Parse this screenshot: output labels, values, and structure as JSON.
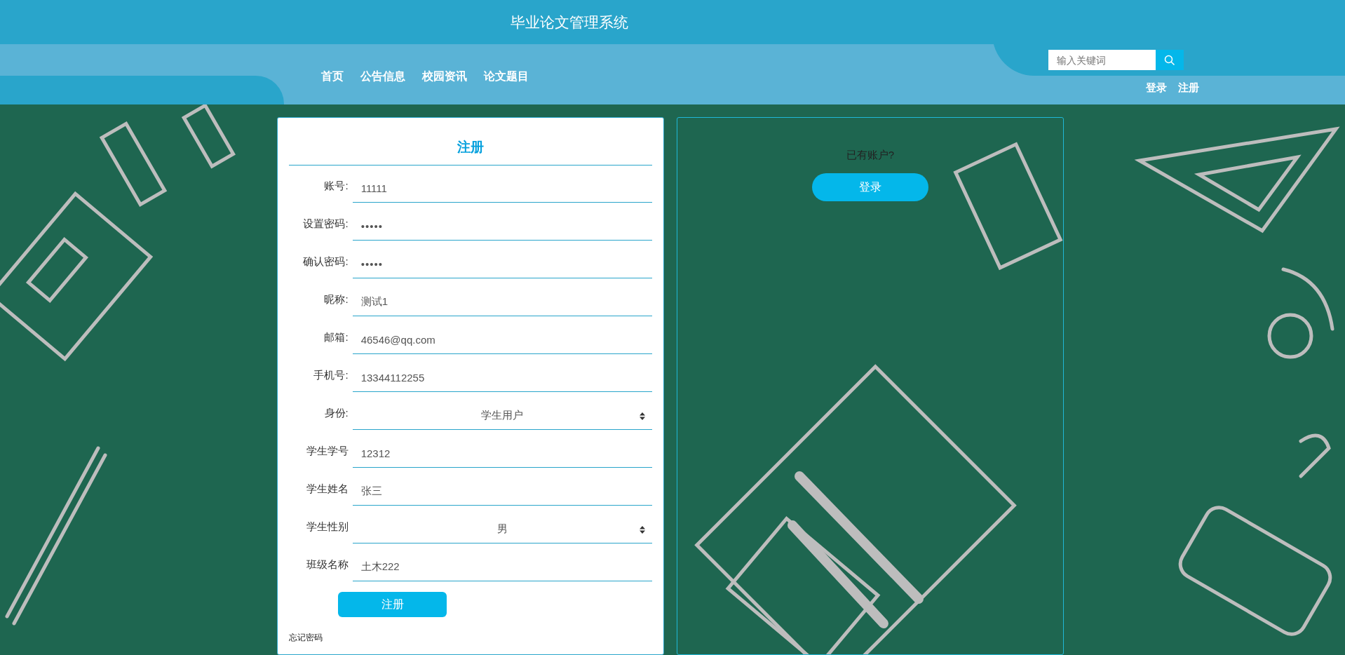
{
  "header": {
    "title": "毕业论文管理系统",
    "nav": [
      {
        "label": "首页"
      },
      {
        "label": "公告信息"
      },
      {
        "label": "校园资讯"
      },
      {
        "label": "论文题目"
      }
    ],
    "search": {
      "placeholder": "输入关键词"
    },
    "account_links": [
      {
        "label": "登录"
      },
      {
        "label": "注册"
      }
    ]
  },
  "register_form": {
    "title": "注册",
    "fields": [
      {
        "label": "账号:",
        "kind": "text",
        "value": "11111"
      },
      {
        "label": "设置密码:",
        "kind": "password",
        "value": "•••••"
      },
      {
        "label": "确认密码:",
        "kind": "password",
        "value": "•••••"
      },
      {
        "label": "昵称:",
        "kind": "text",
        "value": "测试1"
      },
      {
        "label": "邮箱:",
        "kind": "text",
        "value": "46546@qq.com"
      },
      {
        "label": "手机号:",
        "kind": "text",
        "value": "13344112255"
      },
      {
        "label": "身份:",
        "kind": "select",
        "value": "学生用户"
      },
      {
        "label": "学生学号",
        "kind": "text",
        "value": "12312"
      },
      {
        "label": "学生姓名",
        "kind": "text",
        "value": "张三"
      },
      {
        "label": "学生性别",
        "kind": "select",
        "value": "男"
      },
      {
        "label": "班级名称",
        "kind": "text",
        "value": "土木222"
      }
    ],
    "submit": "注册",
    "forgot_link": "忘记密码"
  },
  "login_panel": {
    "prompt": "已有账户?",
    "button": "登录"
  }
}
